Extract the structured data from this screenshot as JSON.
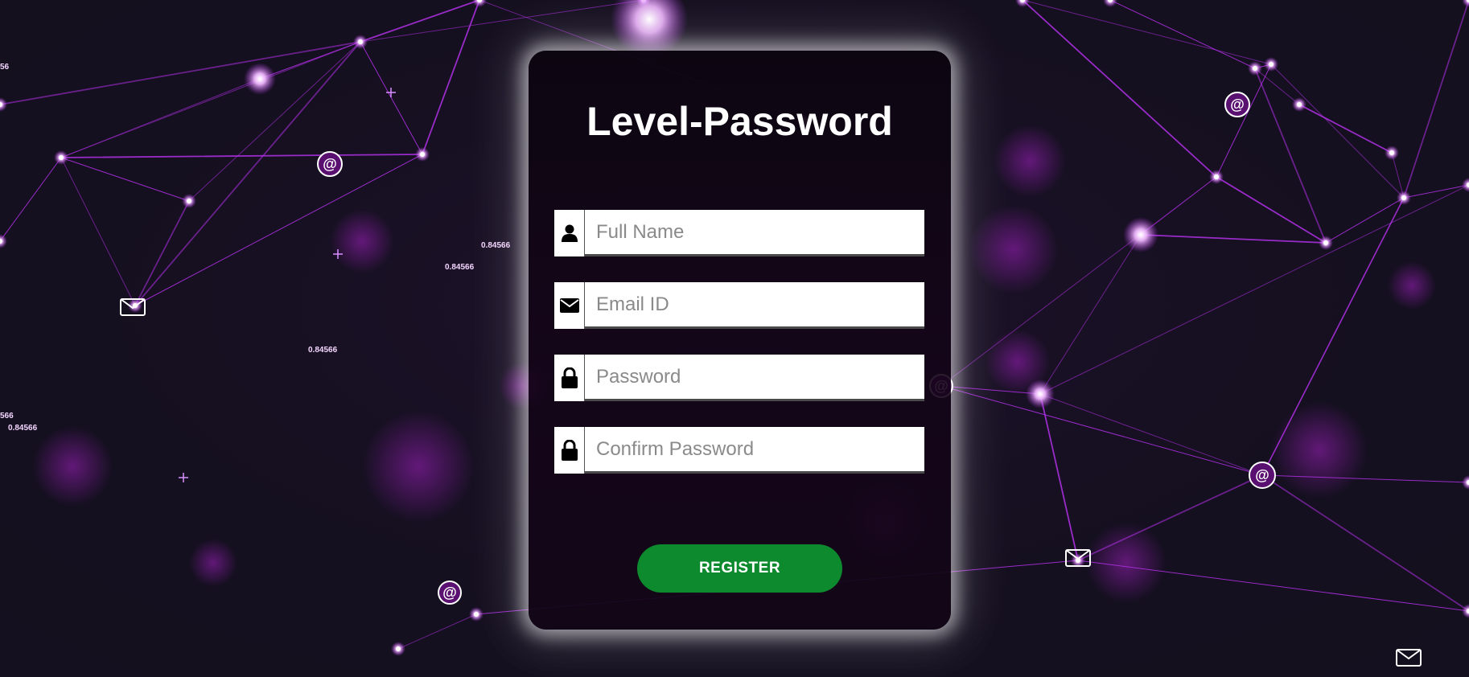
{
  "form": {
    "title": "Level-Password",
    "fields": [
      {
        "icon": "user-icon",
        "placeholder": "Full Name",
        "value": ""
      },
      {
        "icon": "envelope-icon",
        "placeholder": "Email ID",
        "value": ""
      },
      {
        "icon": "lock-icon",
        "placeholder": "Password",
        "value": ""
      },
      {
        "icon": "lock-icon",
        "placeholder": "Confirm Password",
        "value": ""
      }
    ],
    "register_label": "REGISTER",
    "register_color": "#0e8a2e"
  },
  "background": {
    "accent": "#b030e6",
    "numbers": [
      "0.84566",
      "0.84566",
      "0.84566",
      "0.84566",
      "56",
      "566"
    ]
  }
}
